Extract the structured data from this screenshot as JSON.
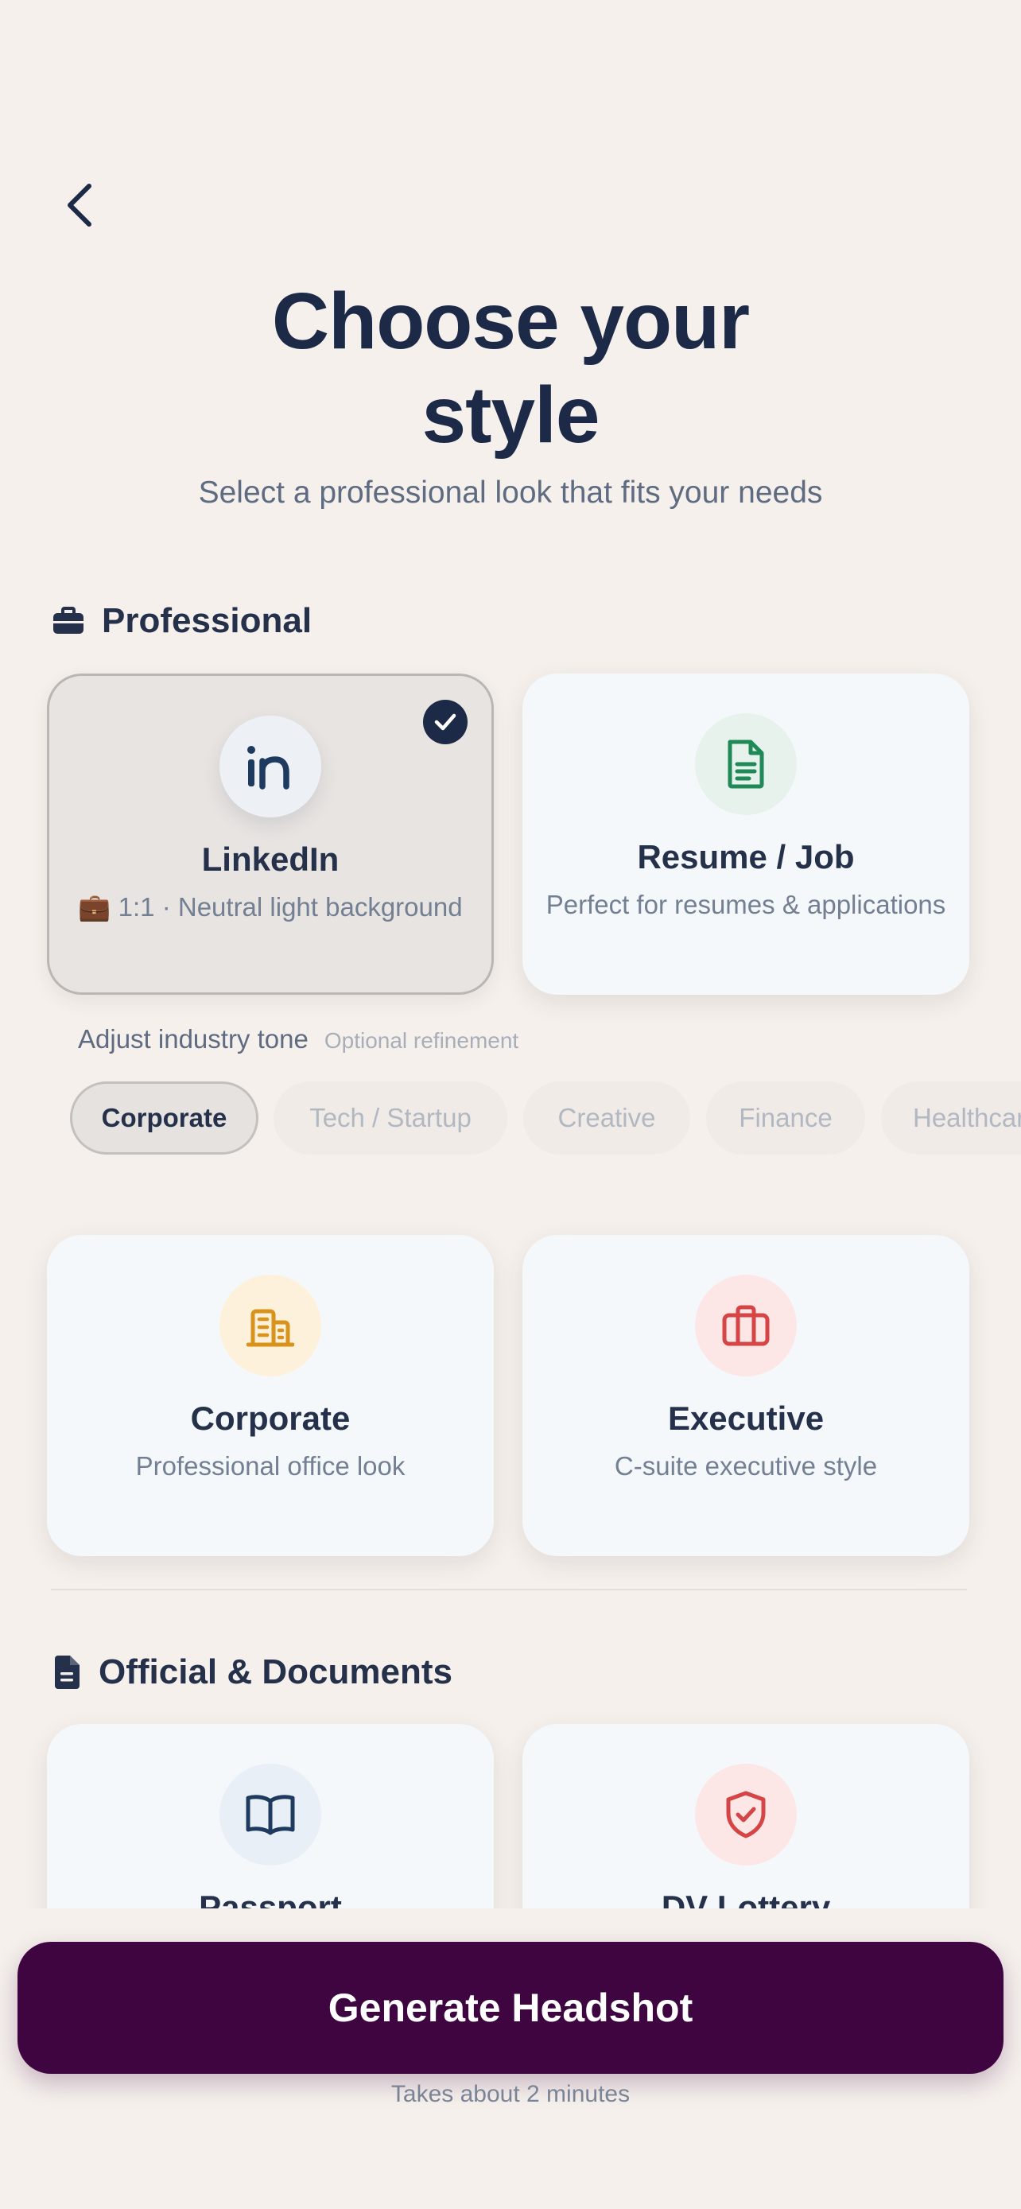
{
  "header": {
    "back_icon": "chevron-left-icon",
    "title_line1": "Choose your",
    "title_line2": "style",
    "subtitle": "Select a professional look that fits your needs"
  },
  "sections": {
    "professional": {
      "icon": "briefcase-icon",
      "label": "Professional",
      "cards": [
        {
          "title": "LinkedIn",
          "desc": "💼 1:1 · Neutral light background",
          "icon": "linkedin-icon",
          "selected": true
        },
        {
          "title": "Resume / Job",
          "desc": "Perfect for resumes & applications",
          "icon": "document-icon",
          "selected": false
        },
        {
          "title": "Corporate",
          "desc": "Professional office look",
          "icon": "building-icon",
          "selected": false
        },
        {
          "title": "Executive",
          "desc": "C-suite executive style",
          "icon": "briefcase-icon",
          "selected": false
        }
      ]
    },
    "official": {
      "icon": "document-icon",
      "label": "Official & Documents",
      "cards": [
        {
          "title": "Passport",
          "icon": "book-open-icon"
        },
        {
          "title": "DV Lottery",
          "icon": "shield-check-icon"
        }
      ]
    }
  },
  "tone": {
    "label": "Adjust industry tone",
    "hint": "Optional refinement",
    "chips": [
      "Corporate",
      "Tech / Startup",
      "Creative",
      "Finance",
      "Healthcare"
    ],
    "selected": "Corporate"
  },
  "cta": {
    "label": "Generate Headshot",
    "note": "Takes about 2 minutes"
  },
  "colors": {
    "background": "#f5f0ec",
    "title": "#1c2a48",
    "cta": "#3e0540",
    "linkedin_icon": "#1e3a5f",
    "resume_icon": "#1f8a57",
    "corporate_icon": "#d9931a",
    "executive_icon": "#d64545"
  }
}
